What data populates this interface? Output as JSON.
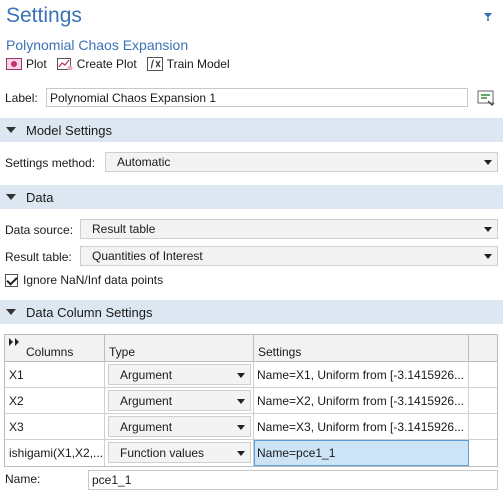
{
  "header": {
    "title": "Settings",
    "subtitle": "Polynomial Chaos Expansion"
  },
  "toolbar": {
    "plot_label": "Plot",
    "create_plot_label": "Create Plot",
    "train_model_label": "Train Model"
  },
  "label_field": {
    "label": "Label:",
    "value": "Polynomial Chaos Expansion 1"
  },
  "sections": {
    "model_settings": "Model Settings",
    "data": "Data",
    "data_column_settings": "Data Column Settings"
  },
  "model_settings": {
    "method_label": "Settings method:",
    "method_value": "Automatic"
  },
  "data": {
    "source_label": "Data source:",
    "source_value": "Result table",
    "table_label": "Result table:",
    "table_value": "Quantities of Interest",
    "ignore_nan_label": "Ignore NaN/Inf data points",
    "ignore_nan_checked": true
  },
  "columns_table": {
    "headers": [
      "Columns",
      "Type",
      "Settings"
    ],
    "rows": [
      {
        "column": "X1",
        "type": "Argument",
        "settings": "Name=X1, Uniform from [-3.1415926..."
      },
      {
        "column": "X2",
        "type": "Argument",
        "settings": "Name=X2, Uniform from [-3.1415926..."
      },
      {
        "column": "X3",
        "type": "Argument",
        "settings": "Name=X3, Uniform from [-3.1415926..."
      },
      {
        "column": "ishigami(X1,X2,...",
        "type": "Function values",
        "settings": "Name=pce1_1"
      }
    ]
  },
  "name_field": {
    "label": "Name:",
    "value": "pce1_1"
  },
  "colors": {
    "accent": "#3a73b8",
    "section_bg": "#dde7f1",
    "selected_cell": "#cde3f6"
  }
}
